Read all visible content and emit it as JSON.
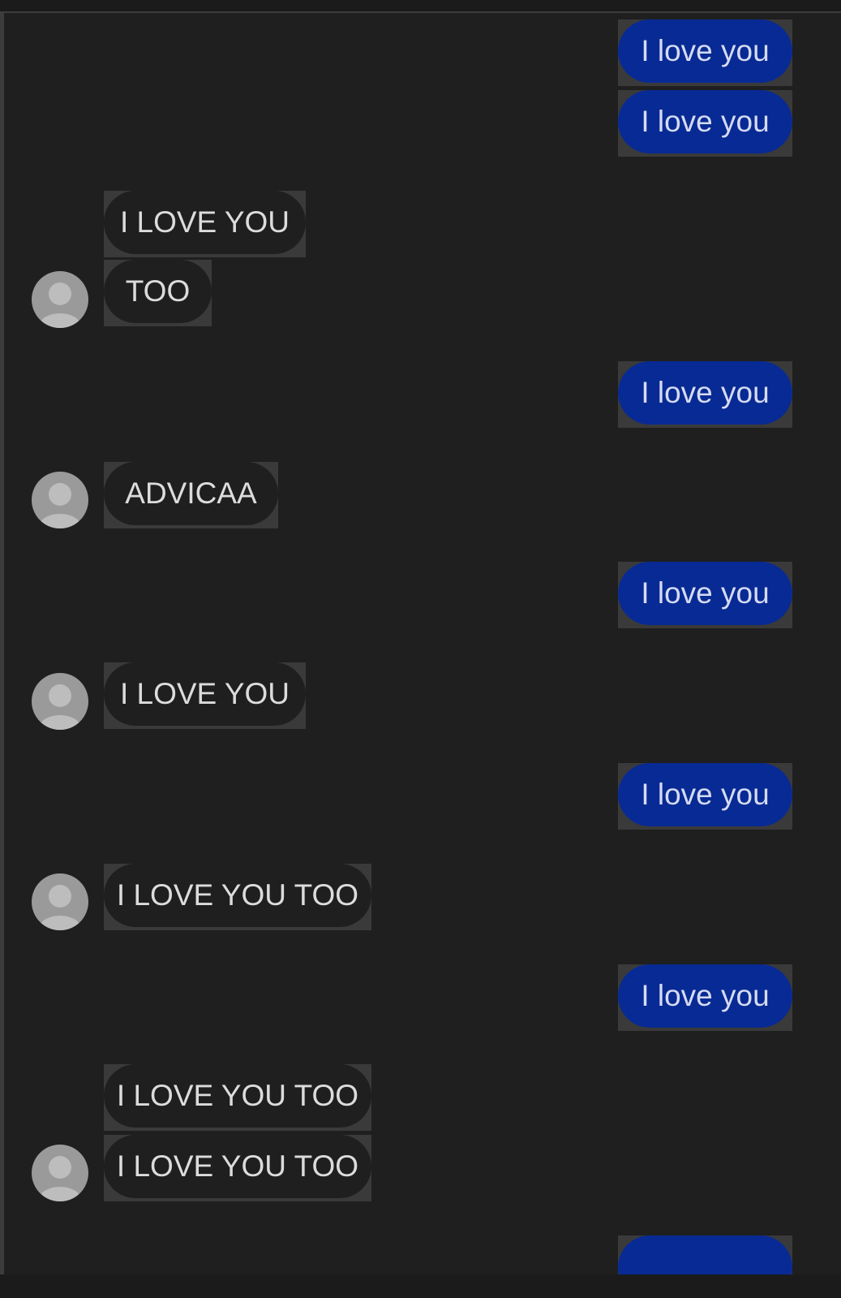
{
  "colors": {
    "background": "#1f1f1f",
    "sent_bubble": "#082a94",
    "sent_text": "#d5dbf2",
    "received_bubble": "#1f1f1f",
    "received_text": "#dcdcdc",
    "avatar": "#9a9a9a"
  },
  "icons": {
    "avatar": "default-contact-avatar-icon"
  },
  "messages": [
    {
      "direction": "sent",
      "text": "I love you"
    },
    {
      "direction": "sent",
      "text": "I love you"
    },
    {
      "direction": "received",
      "text": "I LOVE YOU"
    },
    {
      "direction": "received",
      "text": "TOO"
    },
    {
      "direction": "sent",
      "text": "I love you"
    },
    {
      "direction": "received",
      "text": "ADVICAA"
    },
    {
      "direction": "sent",
      "text": "I love you"
    },
    {
      "direction": "received",
      "text": "I LOVE YOU"
    },
    {
      "direction": "sent",
      "text": "I love you"
    },
    {
      "direction": "received",
      "text": "I LOVE YOU TOO"
    },
    {
      "direction": "sent",
      "text": "I love you"
    },
    {
      "direction": "received",
      "text": "I LOVE YOU TOO"
    },
    {
      "direction": "received",
      "text": "I LOVE YOU TOO"
    },
    {
      "direction": "sent",
      "text": ""
    }
  ]
}
